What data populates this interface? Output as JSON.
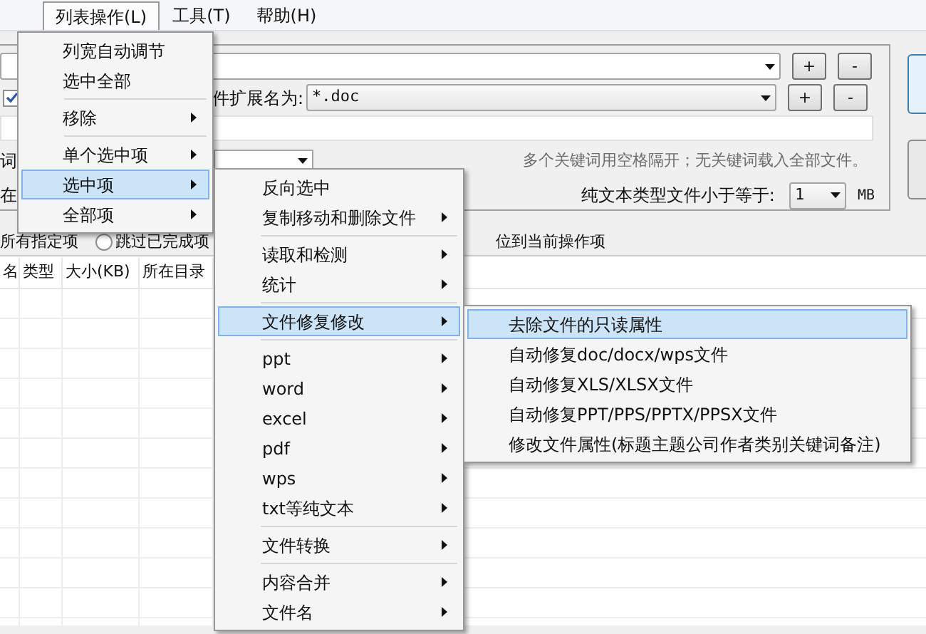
{
  "menubar": [
    {
      "label": "列表操作(L)",
      "selected": true
    },
    {
      "label": "工具(T)",
      "selected": false
    },
    {
      "label": "帮助(H)",
      "selected": false
    }
  ],
  "search_panel": {
    "row_buttons": [
      [
        "+",
        "-"
      ],
      [
        "+",
        "-"
      ]
    ],
    "file_checkbox": {
      "checked": true
    },
    "extension_label": "件扩展名为:",
    "extension_value": "*.doc",
    "keyword_label": "词",
    "location_label": "在",
    "hint": "多个关键词用空格隔开；无关键词载入全部文件。",
    "size_label": "纯文本类型文件小于等于:",
    "size_value": "1",
    "size_unit": "MB"
  },
  "options": [
    {
      "kind": "text",
      "label": "所有指定项"
    },
    {
      "kind": "radio",
      "label": "跳过已完成项",
      "selected": false
    },
    {
      "kind": "text",
      "label": "位到当前操作项"
    }
  ],
  "list": {
    "columns": [
      "名",
      "类型",
      "大小(KB)",
      "所在目录"
    ]
  },
  "menus": [
    {
      "items": [
        {
          "kind": "item",
          "label": "列宽自动调节",
          "submenu": false,
          "selected": false
        },
        {
          "kind": "item",
          "label": "选中全部",
          "submenu": false,
          "selected": false
        },
        {
          "kind": "separator"
        },
        {
          "kind": "item",
          "label": "移除",
          "submenu": true,
          "selected": false
        },
        {
          "kind": "separator"
        },
        {
          "kind": "item",
          "label": "单个选中项",
          "submenu": true,
          "selected": false
        },
        {
          "kind": "item",
          "label": "选中项",
          "submenu": true,
          "selected": true
        },
        {
          "kind": "item",
          "label": "全部项",
          "submenu": true,
          "selected": false
        }
      ]
    },
    {
      "items": [
        {
          "kind": "item",
          "label": "反向选中",
          "submenu": false,
          "selected": false
        },
        {
          "kind": "item",
          "label": "复制移动和删除文件",
          "submenu": true,
          "selected": false
        },
        {
          "kind": "separator"
        },
        {
          "kind": "item",
          "label": "读取和检测",
          "submenu": true,
          "selected": false
        },
        {
          "kind": "item",
          "label": "统计",
          "submenu": true,
          "selected": false
        },
        {
          "kind": "separator"
        },
        {
          "kind": "item",
          "label": "文件修复修改",
          "submenu": true,
          "selected": true
        },
        {
          "kind": "separator"
        },
        {
          "kind": "item",
          "label": "ppt",
          "submenu": true,
          "selected": false
        },
        {
          "kind": "item",
          "label": "word",
          "submenu": true,
          "selected": false
        },
        {
          "kind": "item",
          "label": "excel",
          "submenu": true,
          "selected": false
        },
        {
          "kind": "item",
          "label": "pdf",
          "submenu": true,
          "selected": false
        },
        {
          "kind": "item",
          "label": "wps",
          "submenu": true,
          "selected": false
        },
        {
          "kind": "item",
          "label": "txt等纯文本",
          "submenu": true,
          "selected": false
        },
        {
          "kind": "separator"
        },
        {
          "kind": "item",
          "label": "文件转换",
          "submenu": true,
          "selected": false
        },
        {
          "kind": "separator"
        },
        {
          "kind": "item",
          "label": "内容合并",
          "submenu": true,
          "selected": false
        },
        {
          "kind": "item",
          "label": "文件名",
          "submenu": true,
          "selected": false
        }
      ]
    },
    {
      "items": [
        {
          "kind": "item",
          "label": "去除文件的只读属性",
          "submenu": false,
          "selected": true
        },
        {
          "kind": "item",
          "label": "自动修复doc/docx/wps文件",
          "submenu": false,
          "selected": false
        },
        {
          "kind": "item",
          "label": "自动修复XLS/XLSX文件",
          "submenu": false,
          "selected": false
        },
        {
          "kind": "item",
          "label": "自动修复PPT/PPS/PPTX/PPSX文件",
          "submenu": false,
          "selected": false
        },
        {
          "kind": "item",
          "label": "修改文件属性(标题主题公司作者类别关键词备注)",
          "submenu": false,
          "selected": false
        }
      ]
    }
  ]
}
